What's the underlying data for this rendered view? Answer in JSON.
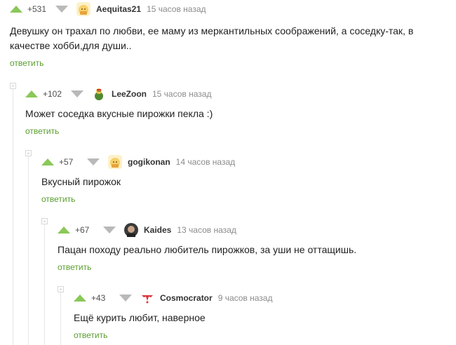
{
  "comments": [
    {
      "rating": "+531",
      "username": "Aequitas21",
      "time": "15 часов назад",
      "avatar_icon": "default-avatar",
      "text": "Девушку он трахал по любви, ее маму из меркантильных соображений, а соседку-так, в качестве хобби,для души..",
      "reply_label": "ответить"
    },
    {
      "rating": "+102",
      "username": "LeeZoon",
      "time": "15 часов назад",
      "avatar_icon": "cartoon-avatar",
      "text": "Может соседка вкусные пирожки пекла :)",
      "reply_label": "ответить"
    },
    {
      "rating": "+57",
      "username": "gogikonan",
      "time": "14 часов назад",
      "avatar_icon": "default-avatar",
      "text": "Вкусный пирожок",
      "reply_label": "ответить"
    },
    {
      "rating": "+67",
      "username": "Kaides",
      "time": "13 часов назад",
      "avatar_icon": "photo-avatar",
      "text": "Пацан походу реально любитель пирожков, за уши не оттащишь.",
      "reply_label": "ответить"
    },
    {
      "rating": "+43",
      "username": "Cosmocrator",
      "time": "9 часов назад",
      "avatar_icon": "logo-avatar",
      "text": "Ещё курить любит, наверное",
      "reply_label": "ответить"
    }
  ],
  "colors": {
    "upvote": "#8ac858",
    "downvote": "#b9b9b9",
    "reply_link": "#5a9e2f",
    "time": "#8b8b8b"
  }
}
